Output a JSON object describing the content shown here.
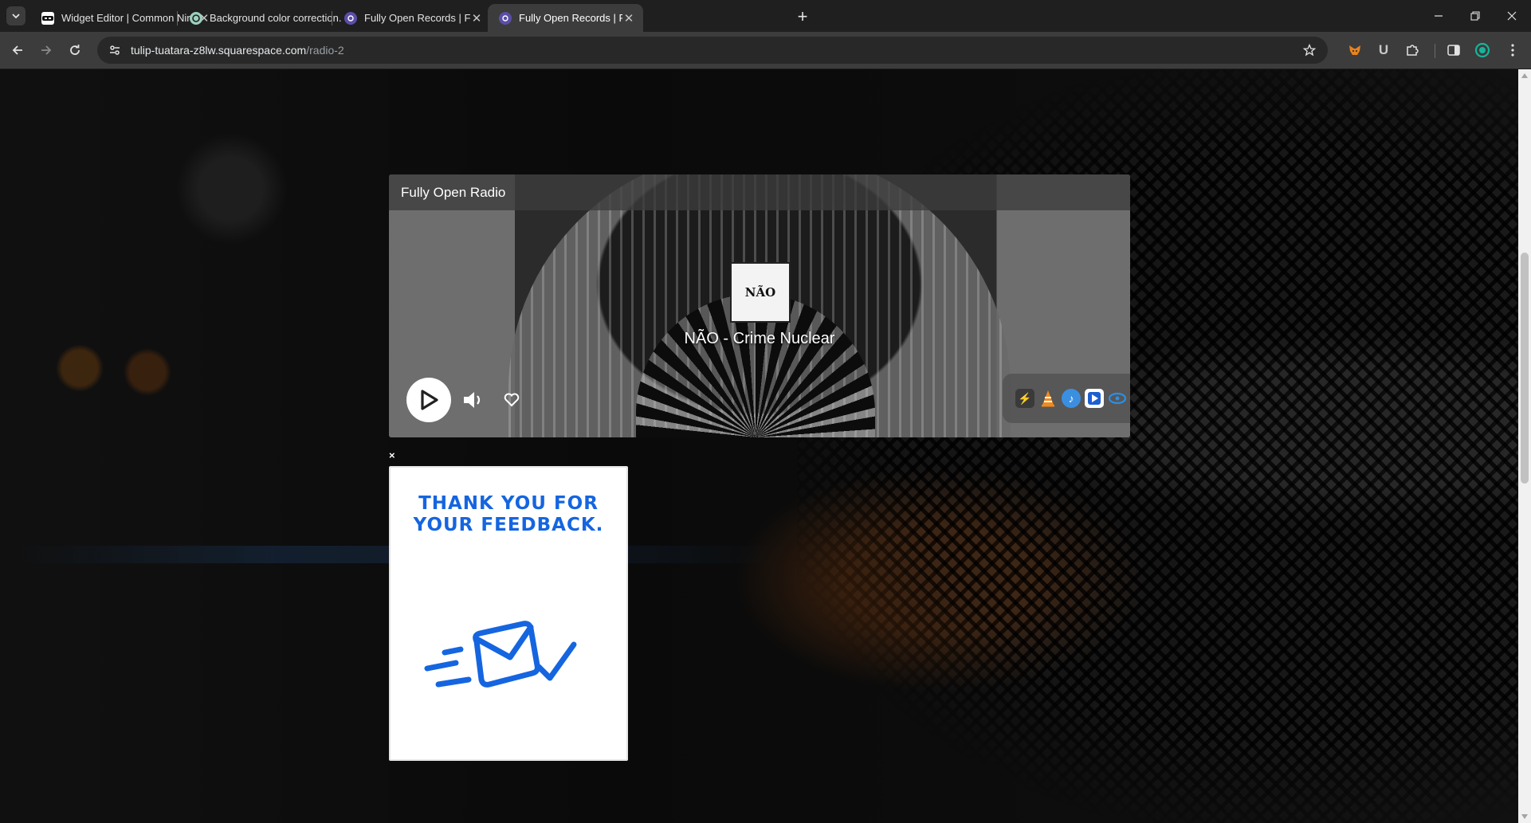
{
  "browser": {
    "tabs": [
      {
        "title": "Widget Editor | Common Ninja",
        "favicon": "common-ninja-icon",
        "active": false
      },
      {
        "title": "Background color correction.",
        "favicon": "chatgpt-icon",
        "active": false
      },
      {
        "title": "Fully Open Records | Fully Open",
        "favicon": "squarespace-icon",
        "active": false
      },
      {
        "title": "Fully Open Records | Fully Open",
        "favicon": "squarespace-icon",
        "active": true
      }
    ],
    "url_host": "tulip-tuatara-z8lw.squarespace.com",
    "url_path": "/radio-2"
  },
  "player": {
    "station_name": "Fully Open Radio",
    "track": "NÃO - Crime Nuclear",
    "cover_text": "NÃO",
    "apps": [
      "winamp-icon",
      "vlc-icon",
      "itunes-icon",
      "windows-media-player-icon",
      "realplayer-icon"
    ]
  },
  "feedback": {
    "close_label": "×",
    "message": "THANK YOU FOR YOUR FEEDBACK.",
    "accent_color": "#1565e0"
  }
}
